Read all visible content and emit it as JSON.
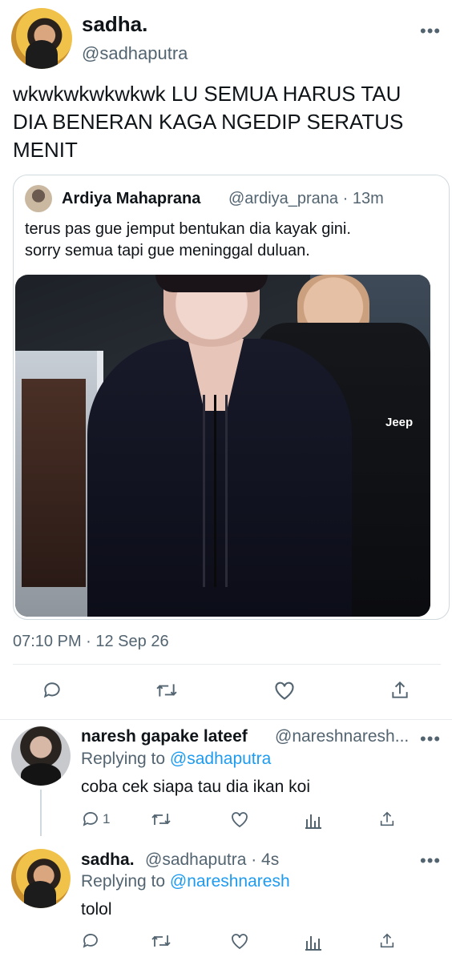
{
  "main_tweet": {
    "display_name": "sadha.",
    "handle": "@sadhaputra",
    "more": "•••",
    "text": "wkwkwkwkwkwk LU SEMUA HARUS TAU DIA BENERAN KAGA NGEDIP SERATUS MENIT",
    "timestamp": "07:10 PM · 12 Sep 26"
  },
  "quote": {
    "display_name": "Ardiya Mahaprana",
    "handle_time": "@ardiya_prana · 13m",
    "text_line1": "terus pas gue jemput bentukan dia kayak gini.",
    "text_line2": "sorry semua tapi gue meninggal duluan.",
    "image_text": "Jeep"
  },
  "replies": [
    {
      "display_name": "naresh gapake lateef",
      "handle": "@nareshnaresh...",
      "more": "•••",
      "replying_prefix": "Replying to ",
      "replying_to": "@sadhaputra",
      "text": "coba cek siapa tau dia ikan koi",
      "reply_count": "1"
    },
    {
      "display_name": "sadha.",
      "handle_time": "@sadhaputra · 4s",
      "more": "•••",
      "replying_prefix": "Replying to ",
      "replying_to": "@nareshnaresh",
      "text": "tolol"
    }
  ],
  "icons": {
    "reply": "reply-icon",
    "retweet": "retweet-icon",
    "like": "like-icon",
    "share": "share-icon",
    "analytics": "analytics-icon",
    "more": "more-icon"
  },
  "colors": {
    "link": "#1d9bf0",
    "secondary_text": "#536471",
    "primary_text": "#0f1419",
    "divider": "#e7ecf0"
  }
}
